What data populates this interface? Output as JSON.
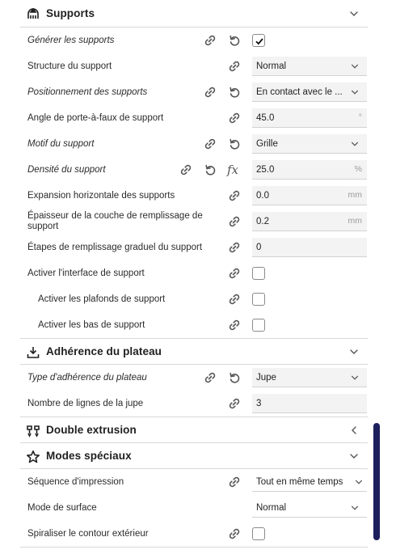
{
  "sections": {
    "supports": {
      "title": "Supports",
      "icon": "supports-icon"
    },
    "adhesion": {
      "title": "Adhérence du plateau",
      "icon": "adhesion-icon"
    },
    "dual": {
      "title": "Double extrusion",
      "icon": "dual-extrusion-icon"
    },
    "special": {
      "title": "Modes spéciaux",
      "icon": "star-icon"
    }
  },
  "supports_rows": {
    "generate": {
      "label": "Générer les supports",
      "checked": true
    },
    "structure": {
      "label": "Structure du support",
      "value": "Normal"
    },
    "placement": {
      "label": "Positionnement des supports",
      "value": "En contact avec le ..."
    },
    "angle": {
      "label": "Angle de porte-à-faux de support",
      "value": "45.0",
      "unit": "°"
    },
    "pattern": {
      "label": "Motif du support",
      "value": "Grille"
    },
    "density": {
      "label": "Densité du support",
      "value": "25.0",
      "unit": "%",
      "fx": "fx"
    },
    "h_expansion": {
      "label": "Expansion horizontale des supports",
      "value": "0.0",
      "unit": "mm"
    },
    "infill_thickness": {
      "label": "Épaisseur de la couche de remplissage de support",
      "value": "0.2",
      "unit": "mm"
    },
    "gradual_steps": {
      "label": "Étapes de remplissage graduel du support",
      "value": "0"
    },
    "interface": {
      "label": "Activer l'interface de support",
      "checked": false
    },
    "roofs": {
      "label": "Activer les plafonds de support",
      "checked": false
    },
    "bottoms": {
      "label": "Activer les bas de support",
      "checked": false
    }
  },
  "adhesion_rows": {
    "type": {
      "label": "Type d'adhérence du plateau",
      "value": "Jupe"
    },
    "skirt_lines": {
      "label": "Nombre de lignes de la jupe",
      "value": "3"
    }
  },
  "special_rows": {
    "sequence": {
      "label": "Séquence d'impression",
      "value": "Tout en même temps"
    },
    "surface": {
      "label": "Mode de surface",
      "value": "Normal"
    },
    "spiralize": {
      "label": "Spiraliser le contour extérieur",
      "checked": false
    }
  },
  "colors": {
    "scrollbar": "#1d1f5c",
    "field_bg": "#f3f3f3"
  }
}
